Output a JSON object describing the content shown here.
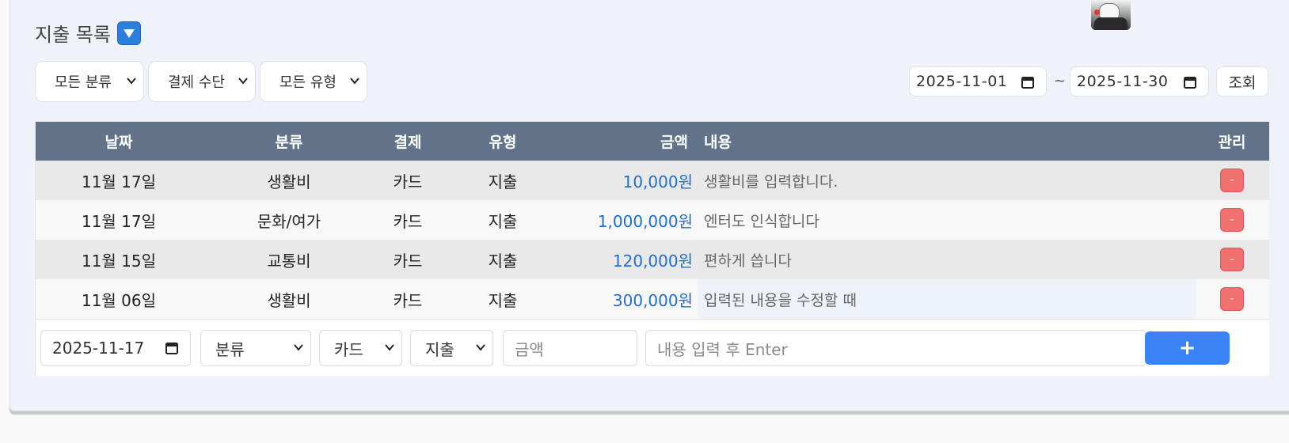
{
  "header": {
    "title": "지출 목록",
    "toggle_icon": "triangle-down-icon"
  },
  "filters": {
    "category": "모든 분류",
    "payment": "결제 수단",
    "type": "모든 유형",
    "date_from": "2025-11-01",
    "date_to": "2025-11-30",
    "range_sep": "~",
    "query_label": "조회"
  },
  "table": {
    "headers": [
      "날짜",
      "분류",
      "결제",
      "유형",
      "금액",
      "내용",
      "관리"
    ],
    "rows": [
      {
        "date": "11월 17일",
        "category": "생활비",
        "payment": "카드",
        "type": "지출",
        "amount": "10,000원",
        "memo": "생활비를 입력합니다.",
        "delete": "-"
      },
      {
        "date": "11월 17일",
        "category": "문화/여가",
        "payment": "카드",
        "type": "지출",
        "amount": "1,000,000원",
        "memo": "엔터도 인식합니다",
        "delete": "-"
      },
      {
        "date": "11월 15일",
        "category": "교통비",
        "payment": "카드",
        "type": "지출",
        "amount": "120,000원",
        "memo": "편하게 씁니다",
        "delete": "-"
      },
      {
        "date": "11월 06일",
        "category": "생활비",
        "payment": "카드",
        "type": "지출",
        "amount": "300,000원",
        "memo": "입력된 내용을 수정할 때",
        "delete": "-"
      }
    ]
  },
  "new_entry": {
    "date": "2025-11-17",
    "category": "분류",
    "payment": "카드",
    "type": "지출",
    "amount_placeholder": "금액",
    "memo_placeholder": "내용 입력 후 Enter",
    "add_label": "+"
  },
  "colors": {
    "header_bg": "#627389",
    "amount": "#1e6fd0",
    "delete": "#f17170",
    "add": "#3b82f6"
  }
}
